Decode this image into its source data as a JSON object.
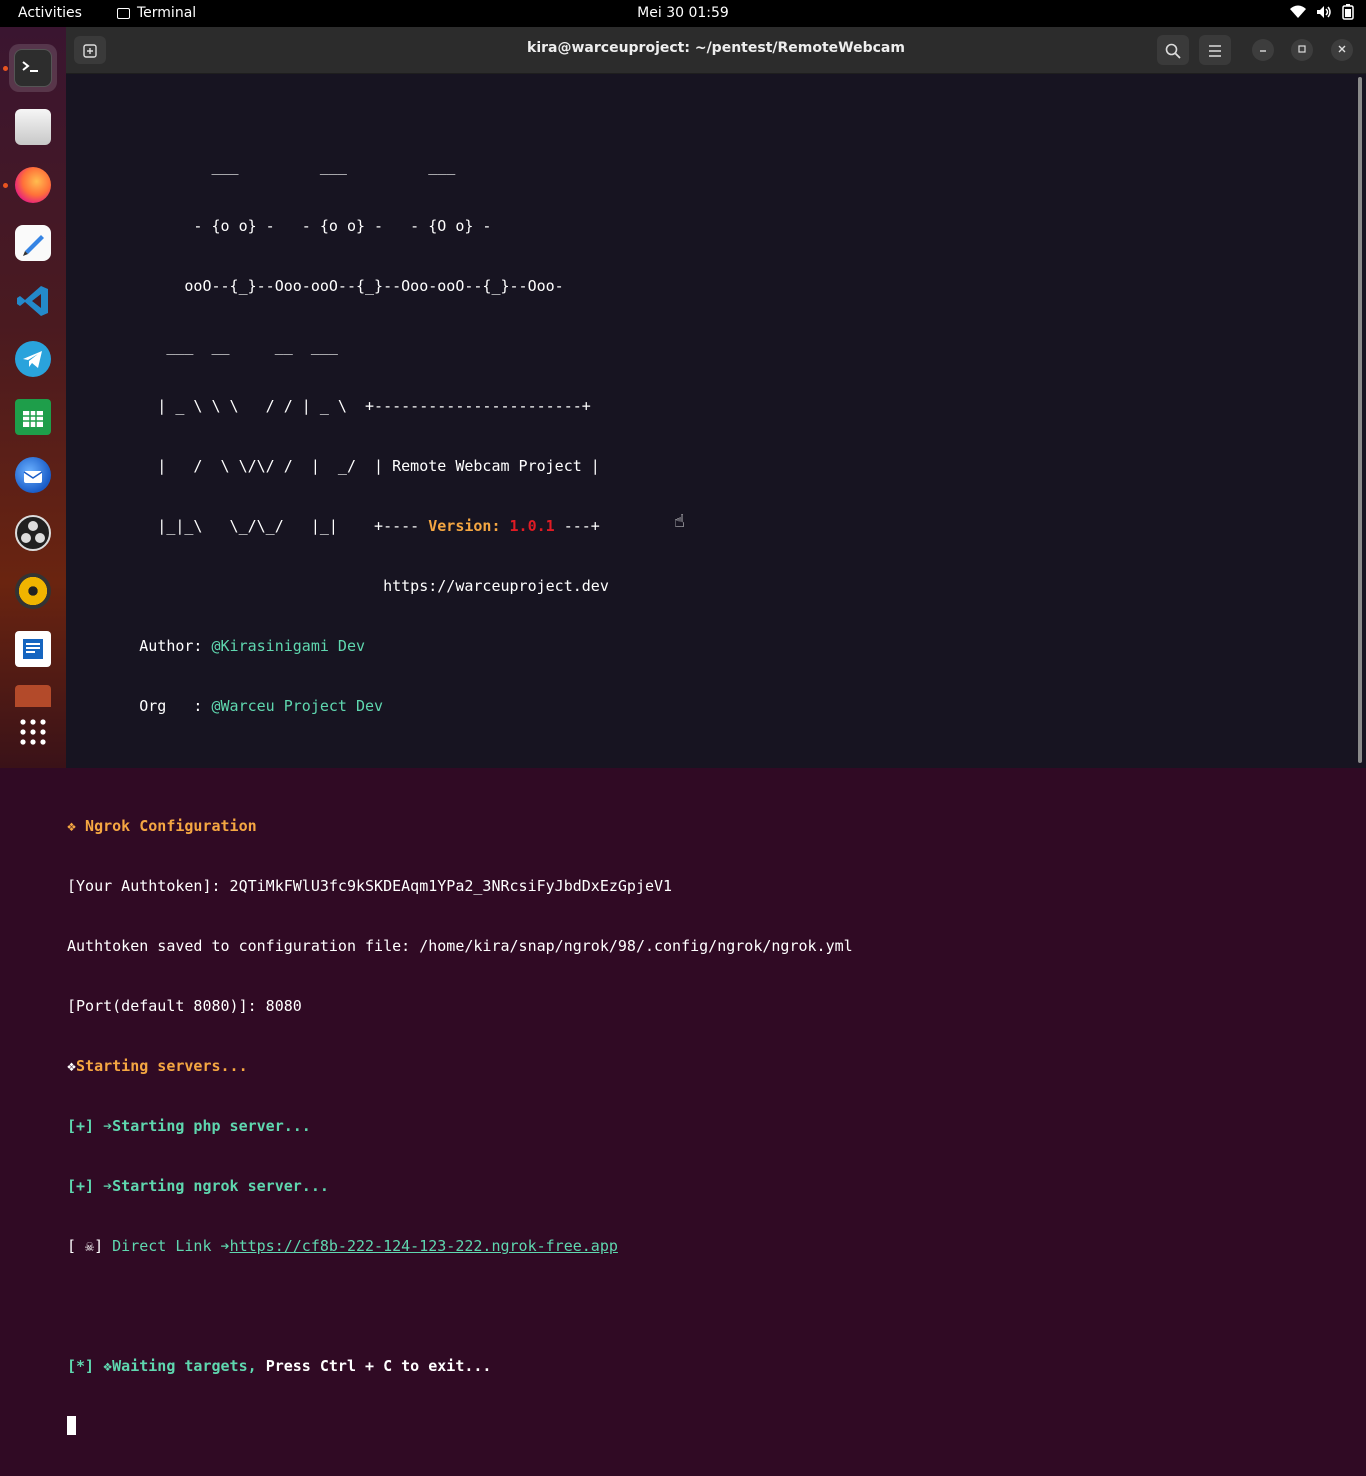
{
  "topbar": {
    "activities": "Activities",
    "app_name": "Terminal",
    "clock": "Mei 30  01:59"
  },
  "window": {
    "title": "kira@warceuproject: ~/pentest/RemoteWebcam"
  },
  "banner": {
    "art1": "                ___         ___         ___",
    "art2": "              - {o o} -   - {o o} -   - {O o} -",
    "art3": "             ooO--{_}--Ooo-ooO--{_}--Ooo-ooO--{_}--Ooo-",
    "art4": "           ___  __     __  ___",
    "art5_a": "          | _ \\ \\ \\   / / | _ \\  ",
    "art5_b": "+-----------------------+",
    "art6_a": "          |   /  \\ \\/\\/ /  |  _/  ",
    "art6_b": "| Remote Webcam Project |",
    "art7_a": "          |_|_\\   \\_/\\_/   |_|    ",
    "art7_b1": "+---- ",
    "version_label": "Version:",
    "version_value": "1.0.1",
    "art7_b2": " ---+",
    "url": "                                   https://warceuproject.dev",
    "author_label": "        Author: ",
    "author_value": "@Kirasinigami Dev",
    "org_label": "        Org   : ",
    "org_value": "@Warceu Project Dev"
  },
  "output": {
    "ngrok_header": "❖ Ngrok Configuration",
    "authtoken_line": "[Your Authtoken]: 2QTiMkFWlU3fc9kSKDEAqm1YPa2_3NRcsiFyJbdDxEzGpjeV1",
    "saved_line": "Authtoken saved to configuration file: /home/kira/snap/ngrok/98/.config/ngrok/ngrok.yml",
    "port_line": "[Port(default 8080)]: 8080",
    "starting_servers_icon": "❖",
    "starting_servers": "Starting servers...",
    "php_line": "[+] ➔Starting php server...",
    "ngrok_line": "[+] ➔Starting ngrok server...",
    "direct_prefix": "[ ☠] ",
    "direct_label": "Direct Link ➔",
    "direct_url": "https://cf8b-222-124-123-222.ngrok-free.app",
    "waiting_prefix": "[*] ❖",
    "waiting_text": "Waiting targets, ",
    "waiting_exit": "Press Ctrl + C to exit..."
  },
  "dock": {
    "items": [
      "terminal-icon",
      "files-icon",
      "firefox-icon",
      "text-editor-icon",
      "vscode-icon",
      "telegram-icon",
      "spreadsheet-icon",
      "thunderbird-icon",
      "obs-icon",
      "rhythmbox-icon",
      "writer-icon",
      "toolbox-icon",
      "app-grid-icon"
    ]
  },
  "colors": {
    "terminal_bg": "#171421",
    "cyan": "#5fd7af",
    "orange": "#f5a742",
    "red": "#e01b24",
    "accent": "#e95420"
  }
}
